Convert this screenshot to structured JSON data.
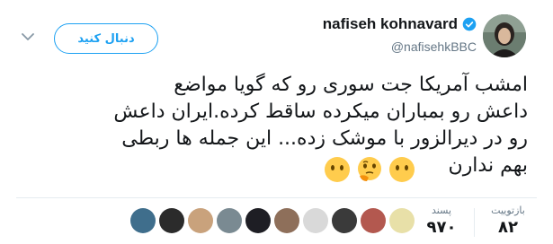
{
  "header": {
    "display_name": "nafiseh kohnavard",
    "handle": "@nafisehkBBC",
    "follow_label": "دنبال کنید",
    "verified_icon": "verified-badge-icon",
    "menu_icon": "chevron-down-icon"
  },
  "tweet": {
    "lines": [
      "امشب آمریکا جت سوری رو که گویا مواضع",
      "داعش رو بمباران میکرده ساقط کرده.ایران داعش",
      "رو در دیرالزور با موشک زده... این جمله ها ربطی",
      "بهم ندارن"
    ],
    "emojis": [
      "neutral-face-emoji",
      "thinking-face-emoji",
      "neutral-face-emoji"
    ]
  },
  "stats": {
    "retweets_label": "بازتوییت",
    "retweets_value": "۸۲",
    "likes_label": "پسند",
    "likes_value": "۹۷۰"
  },
  "likers": {
    "count_shown": 10
  },
  "colors": {
    "accent": "#1da1f2",
    "text": "#14171a",
    "muted": "#657786",
    "divider": "#e6ecf0"
  }
}
